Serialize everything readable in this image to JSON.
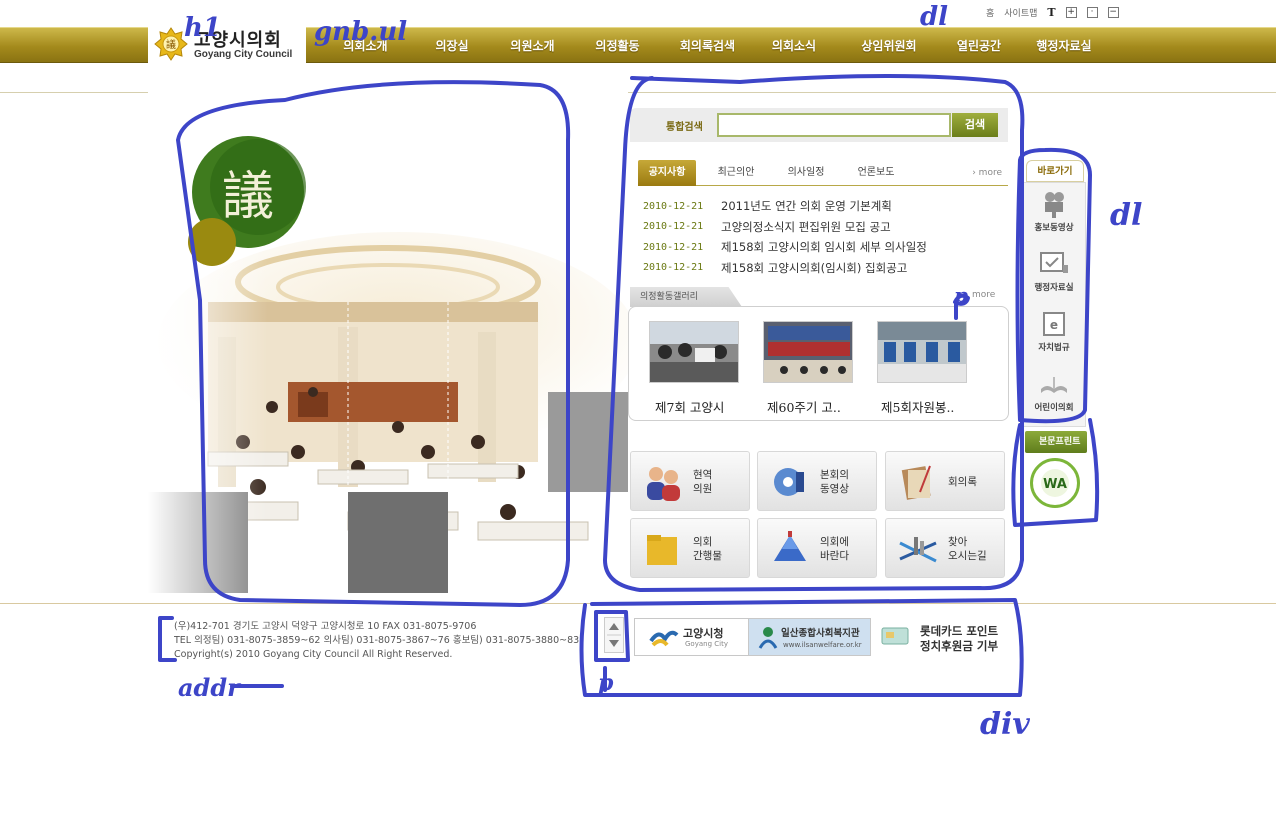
{
  "utility": {
    "home": "홈",
    "sitemap": "사이트맵",
    "text_size": "T",
    "zoom_in": "+",
    "zoom_reset": "·",
    "zoom_out": "−"
  },
  "logo": {
    "ko": "고양시의회",
    "en": "Goyang City Council"
  },
  "gnb": [
    "의회소개",
    "의장실",
    "의원소개",
    "의정활동",
    "회의록검색",
    "의회소식",
    "상임위원회",
    "열린공간",
    "행정자료실"
  ],
  "visual": {
    "character": "議"
  },
  "search": {
    "label": "통합검색",
    "value": "",
    "button": "검색"
  },
  "tabs": {
    "items": [
      "공지사항",
      "최근의안",
      "의사일정",
      "언론보도"
    ],
    "active": "공지사항",
    "more": "› more"
  },
  "notices": [
    {
      "date": "2010-12-21",
      "title": "2011년도 연간 의회 운영 기본계획"
    },
    {
      "date": "2010-12-21",
      "title": "고양의정소식지 편집위원 모집 공고"
    },
    {
      "date": "2010-12-21",
      "title": "제158회 고양시의회 임시회 세부 의사일정"
    },
    {
      "date": "2010-12-21",
      "title": "제158회 고양시의회(임시회) 집회공고"
    }
  ],
  "gallery": {
    "title": "의정활동갤러리",
    "more": "more",
    "items": [
      {
        "caption": "제7회 고양시"
      },
      {
        "caption": "제60주기 고.."
      },
      {
        "caption": "제5회자원봉.."
      }
    ]
  },
  "quick": [
    {
      "label": "현역\n의원",
      "icon": "people-icon"
    },
    {
      "label": "본회의\n동영상",
      "icon": "disc-icon"
    },
    {
      "label": "회의록",
      "icon": "book-icon"
    },
    {
      "label": "의회\n간행물",
      "icon": "folder-icon"
    },
    {
      "label": "의회에\n바란다",
      "icon": "pyramid-icon"
    },
    {
      "label": "찾아\n오시는길",
      "icon": "map-icon"
    }
  ],
  "side": {
    "title": "바로가기",
    "items": [
      {
        "label": "홍보동영상",
        "icon": "camera-icon"
      },
      {
        "label": "행정자료실",
        "icon": "monitor-check-icon"
      },
      {
        "label": "자치법규",
        "icon": "e-doc-icon"
      },
      {
        "label": "어린이의회",
        "icon": "open-book-icon"
      }
    ],
    "print": "본문프린트",
    "wa_mark": "WA"
  },
  "footer": {
    "line1": "(우)412-701 경기도 고양시 덕양구 고양시청로 10   FAX 031-8075-9706",
    "line2": "TEL 의정팀) 031-8075-3859~62 의사팀) 031-8075-3867~76 홍보팀) 031-8075-3880~83",
    "line3": "Copyright(s) 2010 Goyang City Council All Right Reserved."
  },
  "banners": {
    "goyang": "고양시청",
    "goyang_en": "Goyang City",
    "ilsan": "일산종합사회복지관",
    "ilsan_url": "www.ilsanwelfare.or.kr",
    "lotte1": "롯데카드 포인트",
    "lotte2": "정치후원금 기부"
  },
  "annotations": [
    "h1",
    "gnb.ul",
    "dl",
    "dl",
    "div",
    "p",
    "p",
    "addr"
  ],
  "colors": {
    "gnb": "#a48a1c",
    "accent_green": "#6b7e1a",
    "annotation": "#3d45c8"
  }
}
